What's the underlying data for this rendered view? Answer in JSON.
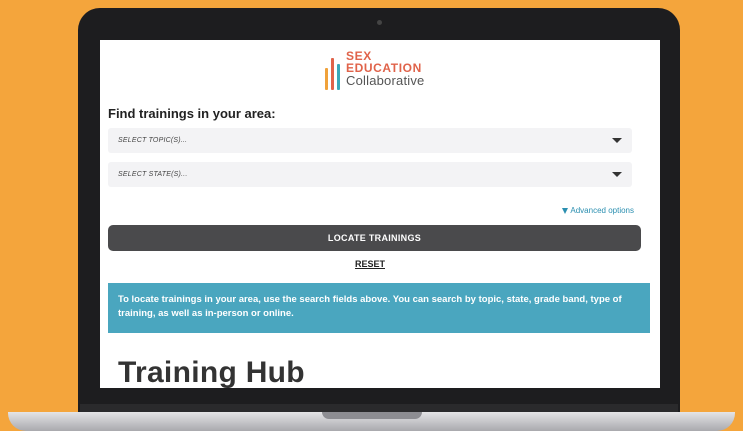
{
  "logo": {
    "line1": "SEX",
    "line2": "EDUCATION",
    "line3": "Collaborative"
  },
  "search": {
    "heading": "Find trainings in your area:",
    "topic_placeholder": "SELECT TOPIC(S)...",
    "state_placeholder": "SELECT STATE(S)...",
    "advanced_label": "Advanced options",
    "locate_label": "LOCATE TRAININGS",
    "reset_label": "RESET"
  },
  "info_text": "To locate trainings in your area, use the search fields above. You can search by topic, state, grade band, type of training, as well as in-person or online.",
  "page_title": "Training Hub",
  "colors": {
    "background": "#f4a53c",
    "accent_teal": "#4aa6bf",
    "brand_coral": "#e0634a",
    "button_dark": "#4a4a4c"
  },
  "icons": {
    "topic_caret": "caret-down-icon",
    "state_caret": "caret-down-icon",
    "advanced": "filter-icon"
  }
}
